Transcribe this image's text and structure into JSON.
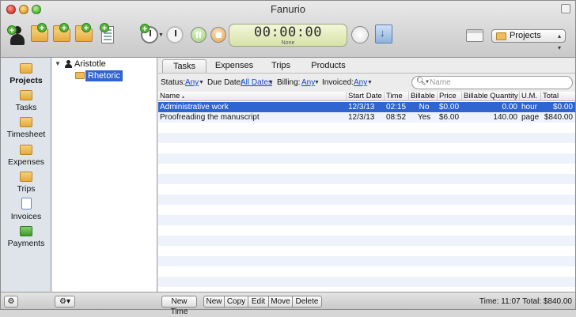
{
  "window": {
    "title": "Fanurio"
  },
  "toolbar": {
    "icons": [
      "add-client-icon",
      "add-project-icon",
      "add-task-icon",
      "add-timesheet-icon",
      "add-invoice-icon",
      "start-timer-icon",
      "idle-clock-icon",
      "pause-icon",
      "stop-icon",
      "gauge-icon",
      "export-icon",
      "toggle-pane-icon"
    ],
    "timer_value": "00:00:00",
    "timer_sub": "None",
    "view_select": "Projects"
  },
  "sidebar": {
    "items": [
      {
        "label": "Projects",
        "icon": "projects-icon",
        "selected": true
      },
      {
        "label": "Tasks",
        "icon": "tasks-icon"
      },
      {
        "label": "Timesheet",
        "icon": "timesheet-icon"
      },
      {
        "label": "Expenses",
        "icon": "expenses-icon"
      },
      {
        "label": "Trips",
        "icon": "trips-icon"
      },
      {
        "label": "Invoices",
        "icon": "invoices-icon"
      },
      {
        "label": "Payments",
        "icon": "payments-icon"
      }
    ]
  },
  "tree": {
    "client": "Aristotle",
    "project": "Rhetoric"
  },
  "tabs": [
    "Tasks",
    "Expenses",
    "Trips",
    "Products"
  ],
  "filters": {
    "status_label": "Status:",
    "status_value": "Any",
    "due_label": "Due Date:",
    "due_value": "All Dates",
    "billing_label": "Billing:",
    "billing_value": "Any",
    "invoiced_label": "Invoiced:",
    "invoiced_value": "Any",
    "search_placeholder": "Name"
  },
  "table": {
    "columns": [
      "Name",
      "Start Date",
      "Time",
      "Billable",
      "Price",
      "Billable Quantity",
      "U.M.",
      "Total"
    ],
    "rows": [
      {
        "name": "Administrative work",
        "start": "12/3/13",
        "time": "02:15",
        "billable": "No",
        "price": "$0.00",
        "qty": "0.00",
        "um": "hour",
        "total": "$0.00",
        "selected": true
      },
      {
        "name": "Proofreading the manuscript",
        "start": "12/3/13",
        "time": "08:52",
        "billable": "Yes",
        "price": "$6.00",
        "qty": "140.00",
        "um": "page",
        "total": "$840.00"
      }
    ]
  },
  "bottom": {
    "new_time": "New Time",
    "new": "New",
    "copy": "Copy",
    "edit": "Edit",
    "move": "Move",
    "delete": "Delete",
    "totals": "Time: 11:07 Total: $840.00"
  },
  "colors": {
    "selection": "#2f64d1",
    "stripe": "#eef3fb",
    "timer": "#e4ebbe",
    "link": "#1a47c6"
  }
}
